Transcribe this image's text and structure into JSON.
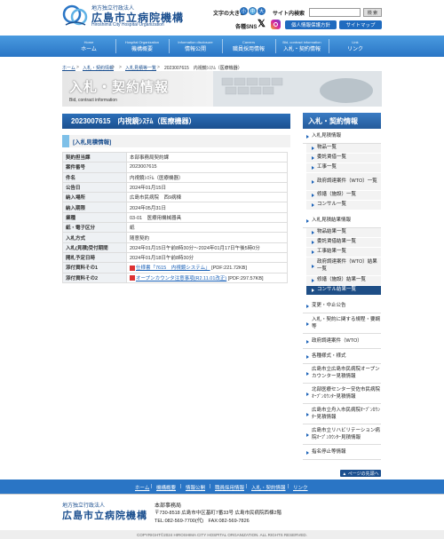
{
  "header": {
    "org_small": "地方独立行政法人",
    "org_name": "広島市立病院機構",
    "org_en": "Hiroshima City Hospital Organization",
    "font_size_label": "文字の大きさ",
    "font_small": "小",
    "font_medium": "中",
    "font_large": "大",
    "search_label": "サイト内検索",
    "search_button": "検 索",
    "sns_label": "各種SNS",
    "privacy_button": "個人情報保護方針",
    "sitemap_button": "サイトマップ"
  },
  "nav": [
    {
      "en": "Home",
      "jp": "ホーム"
    },
    {
      "en": "Hospital Organization",
      "jp": "機構概要"
    },
    {
      "en": "Information disclosure",
      "jp": "情報公開"
    },
    {
      "en": "Careers",
      "jp": "職員採用情報"
    },
    {
      "en": "Bid, contract information",
      "jp": "入札・契約情報"
    },
    {
      "en": "Link",
      "jp": "リンク"
    }
  ],
  "breadcrumb": {
    "home": "ホーム",
    "sep": ">",
    "item1": "入札・契約情報",
    "item2": "入札見積等一覧",
    "current": "2023007615　内視鏡ｼｽﾃﾑ（医療機器）"
  },
  "banner": {
    "title": "入札・契約情報",
    "subtitle": "Bid, contract information"
  },
  "main": {
    "title": "2023007615　内視鏡ｼｽﾃﾑ（医療機器）",
    "section": "[入札見積情報]",
    "rows": [
      {
        "key": "契約担当課",
        "value": "本部事務局契約課"
      },
      {
        "key": "案件番号",
        "value": "2023007615"
      },
      {
        "key": "件名",
        "value": "内視鏡ｼｽﾃﾑ（医療機器）"
      },
      {
        "key": "公告日",
        "value": "2024年01月15日"
      },
      {
        "key": "納入場所",
        "value": "広島市民病院　西9病棟"
      },
      {
        "key": "納入期限",
        "value": "2024年05月31日"
      },
      {
        "key": "業種",
        "value": "03-01　医療用機械器具"
      },
      {
        "key": "紙・電子区分",
        "value": "紙"
      },
      {
        "key": "入札方式",
        "value": "随意契約"
      },
      {
        "key": "入札(見積)受付期間",
        "value": "2024年01月15日午前8時30分～2024年01月17日午後5時0分"
      },
      {
        "key": "開札予定日時",
        "value": "2024年01月18日午前8時30分"
      }
    ],
    "attach1_key": "添付資料その1",
    "attach1_link": "仕様書「7615　内視鏡システム」",
    "attach1_size": "[PDF:221.72KB]",
    "attach2_key": "添付資料その2",
    "attach2_link": "オープンカウンタ注意事項(R2.11.01改正)",
    "attach2_size": "[PDF:297.57KB]"
  },
  "sidebar": {
    "title": "入札・契約情報",
    "sec1": "入札見積情報",
    "sec1_items": [
      "物品一覧",
      "委託賃借一覧",
      "工事一覧",
      "政府調達案件（WTO）一覧",
      "修繕（施設）一覧",
      "コンサル一覧"
    ],
    "sec2": "入札見積結果情報",
    "sec2_items": [
      "物品結果一覧",
      "委託賃借結果一覧",
      "工事結果一覧",
      "政府調達案件（WTO）結果一覧",
      "修繕（施設）結果一覧",
      "コンサル結果一覧"
    ],
    "items": [
      "変更・中止公告",
      "入札・契約に関する規程・要綱等",
      "政府調達案件（WTO）",
      "各種様式・様式",
      "広島市立広島市民病院オープンカウンター見積情報",
      "北部医療センター安佐市民病院ｵｰﾌﾟﾝｶｳﾝﾀｰ見積情報",
      "広島市立舟入市民病院ｵｰﾌﾟﾝｶｳﾝﾀｰ見積情報",
      "広島市立リハビリテーション病院ｵｰﾌﾟﾝｶｳﾝﾀｰ見積情報",
      "指名停止等情報"
    ]
  },
  "footer": {
    "page_top": "▲ ページの先頭へ",
    "links": [
      "ホーム",
      "機構概要",
      "情報公開",
      "職員採用情報",
      "入札・契約情報",
      "リンク"
    ],
    "sep": "|",
    "org_small": "地方独立行政法人",
    "org_name": "広島市立病院機構",
    "office": "本部事務局",
    "address": "〒730-8518 広島市中区基町7番33号 広島市民病院西棟2階",
    "tel": "TEL:082-569-7700(代)　FAX:082-569-7826",
    "copyright": "COPYRIGHT©2024 HIROSHIMA CITY HOSPITAL ORGANIZATION. ALL RIGHTS RESERVED."
  },
  "colors": {
    "brand_blue": "#1b4f8f",
    "nav_blue": "#2a75c5",
    "link": "#1b62b8"
  }
}
